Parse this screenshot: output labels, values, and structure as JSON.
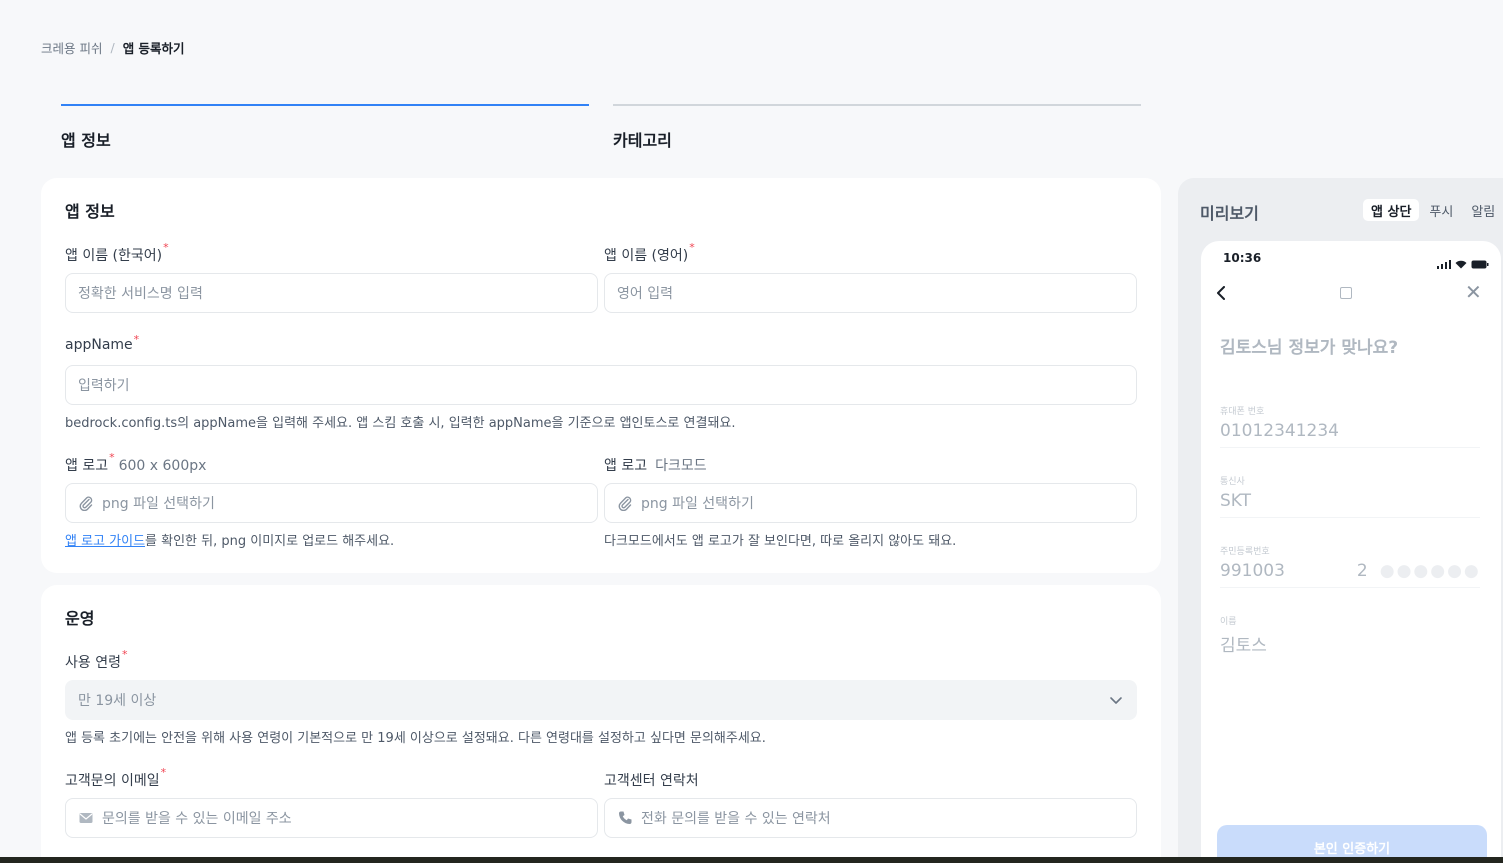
{
  "breadcrumb": {
    "parent": "크레용 피쉬",
    "separator": "/",
    "current": "앱 등록하기"
  },
  "steps": [
    {
      "label": "앱 정보",
      "active": true
    },
    {
      "label": "카테고리",
      "active": false
    }
  ],
  "app_info": {
    "title": "앱 정보",
    "name_ko": {
      "label": "앱 이름 (한국어)",
      "required": "*",
      "placeholder": "정확한 서비스명 입력",
      "value": ""
    },
    "name_en": {
      "label": "앱 이름 (영어)",
      "required": "*",
      "placeholder": "영어 입력",
      "value": ""
    },
    "app_name": {
      "label": "appName",
      "required": "*",
      "placeholder": "입력하기",
      "value": "",
      "help": "bedrock.config.ts의 appName을 입력해 주세요. 앱 스킴 호출 시, 입력한 appName을 기준으로 앱인토스로 연결돼요."
    },
    "logo": {
      "label": "앱 로고",
      "required": "*",
      "size": "600 x 600px",
      "file_placeholder": "png 파일 선택하기",
      "help_link": "앱 로고 가이드",
      "help_rest": "를 확인한 뒤, png 이미지로 업로드 해주세요."
    },
    "logo_dark": {
      "label": "앱 로고",
      "sub": "다크모드",
      "file_placeholder": "png 파일 선택하기",
      "help": "다크모드에서도 앱 로고가 잘 보인다면, 따로 올리지 않아도 돼요."
    }
  },
  "operation": {
    "title": "운영",
    "age": {
      "label": "사용 연령",
      "required": "*",
      "value": "만 19세 이상",
      "help": "앱 등록 초기에는 안전을 위해 사용 연령이 기본적으로 만 19세 이상으로 설정돼요. 다른 연령대를 설정하고 싶다면 문의해주세요."
    },
    "email": {
      "label": "고객문의 이메일",
      "required": "*",
      "placeholder": "문의를 받을 수 있는 이메일 주소"
    },
    "phone": {
      "label": "고객센터 연락처",
      "placeholder": "전화 문의를 받을 수 있는 연락처"
    }
  },
  "preview": {
    "title": "미리보기",
    "tabs": [
      {
        "label": "앱 상단",
        "active": true
      },
      {
        "label": "푸시",
        "active": false
      },
      {
        "label": "알림",
        "active": false
      }
    ],
    "phone": {
      "time": "10:36",
      "question": "김토스님 정보가 맞나요?",
      "fields": [
        {
          "label": "휴대폰 번호",
          "value": "01012341234"
        },
        {
          "label": "통신사",
          "value": "SKT"
        },
        {
          "label": "주민등록번호",
          "value": "991003",
          "value2": "2",
          "mask": "●●●●●●"
        },
        {
          "label": "이름",
          "value": "김토스"
        }
      ],
      "cta": "본인 인증하기"
    }
  },
  "colors": {
    "accent": "#3182f6",
    "required": "#f04452",
    "background": "#f7f8fa"
  }
}
